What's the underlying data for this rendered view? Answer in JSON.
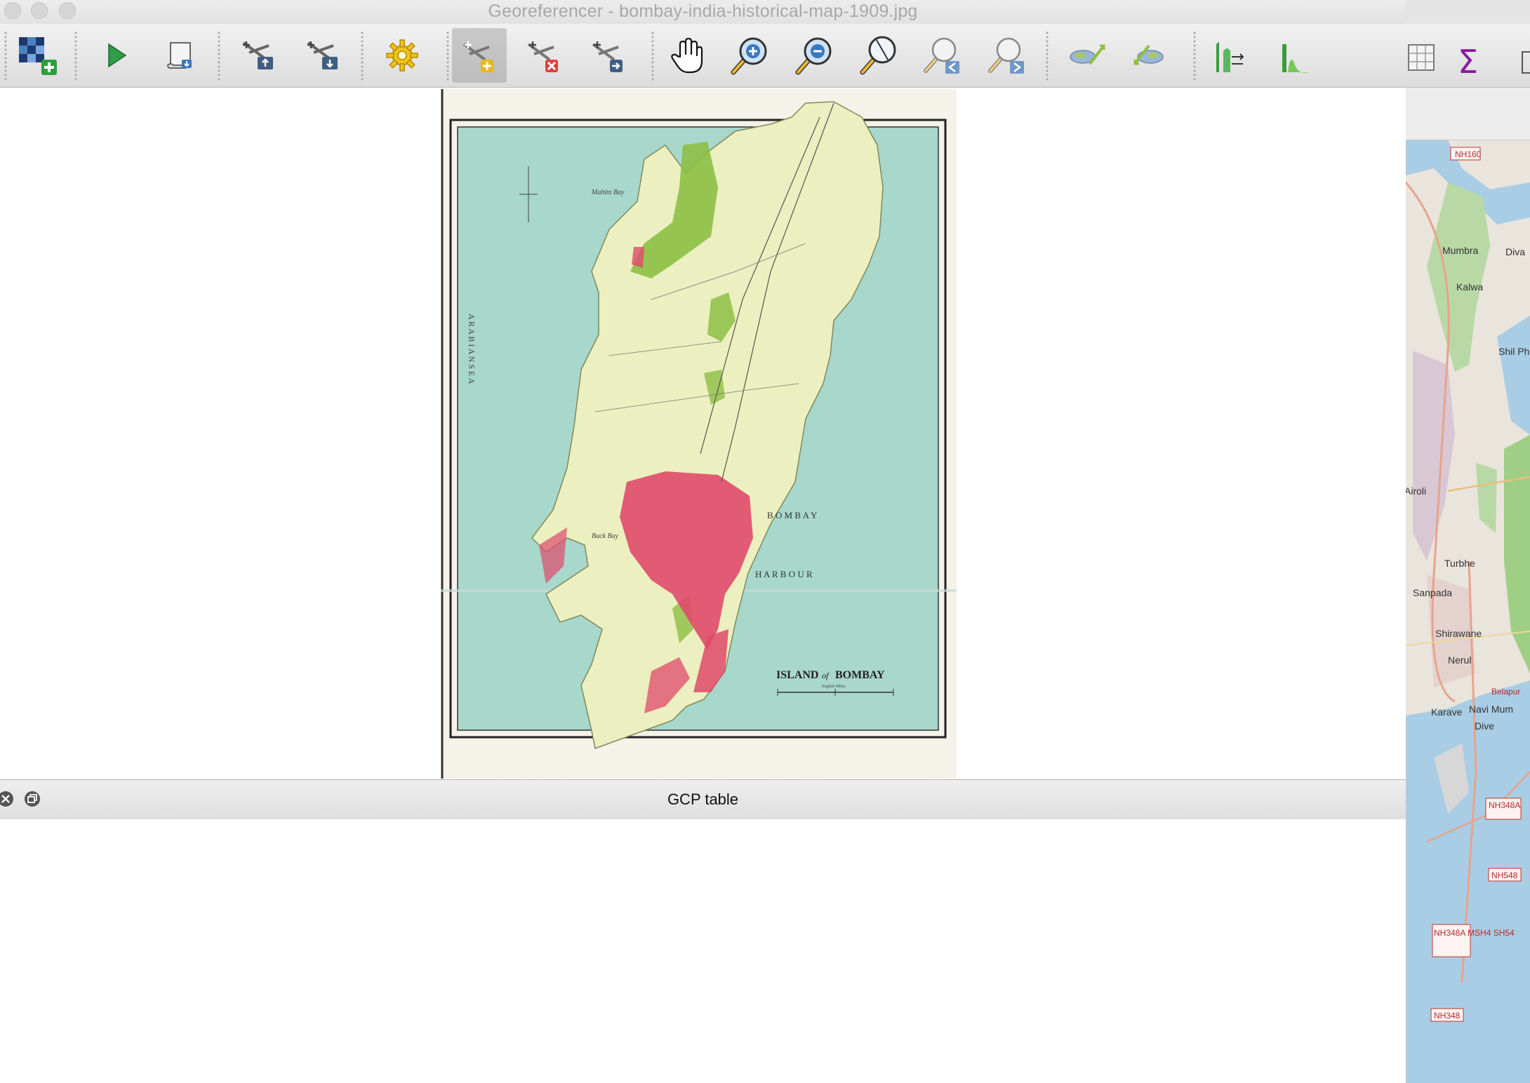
{
  "window": {
    "title": "Georeferencer - bombay-india-historical-map-1909.jpg"
  },
  "toolbar": {
    "buttons": [
      {
        "name": "open-raster",
        "icon": "open-raster-icon"
      },
      {
        "name": "start-georeferencing",
        "icon": "play-icon"
      },
      {
        "name": "generate-gdal-script",
        "icon": "script-icon"
      },
      {
        "name": "load-gcp-points",
        "icon": "load-gcp-icon"
      },
      {
        "name": "save-gcp-points",
        "icon": "save-gcp-icon"
      },
      {
        "name": "transformation-settings",
        "icon": "gear-icon"
      },
      {
        "name": "add-point",
        "icon": "add-point-icon"
      },
      {
        "name": "delete-point",
        "icon": "delete-point-icon"
      },
      {
        "name": "move-gcp-point",
        "icon": "move-point-icon"
      },
      {
        "name": "pan",
        "icon": "hand-icon"
      },
      {
        "name": "zoom-in",
        "icon": "zoom-in-icon"
      },
      {
        "name": "zoom-out",
        "icon": "zoom-out-icon"
      },
      {
        "name": "zoom-to-layer",
        "icon": "zoom-layer-icon"
      },
      {
        "name": "zoom-last",
        "icon": "zoom-last-icon"
      },
      {
        "name": "zoom-next",
        "icon": "zoom-next-icon"
      },
      {
        "name": "link-georeferencer-to-qgis",
        "icon": "link-geo-icon"
      },
      {
        "name": "link-qgis-to-georeferencer",
        "icon": "link-qgis-icon"
      },
      {
        "name": "full-histogram-stretch",
        "icon": "histogram-full-icon"
      },
      {
        "name": "local-histogram-stretch",
        "icon": "histogram-local-icon"
      }
    ]
  },
  "map": {
    "title_main": "ISLAND",
    "title_of": "of",
    "title_place": "BOMBAY",
    "label_bombay": "B O M B A Y",
    "label_harbour": "H A R B O U R",
    "label_sea": "A R A B I A N   S E A",
    "label_mahim": "Mahim Bay",
    "label_back": "Back Bay",
    "label_scale": "English Miles",
    "colors": {
      "sea": "#a8d7cb",
      "land": "#ecefbf",
      "green": "#8dbf45",
      "town": "#e04a6b"
    }
  },
  "gcp": {
    "title": "GCP table"
  },
  "background_map": {
    "labels": [
      "NH160",
      "Mumbra",
      "Diva",
      "Kalwa",
      "Shil Pha",
      "Airoli",
      "Turbhe",
      "Sanpada",
      "Shirawane",
      "Nerul",
      "Belapur",
      "Navi Mum",
      "Karave",
      "Dive",
      "NH348A",
      "NH548",
      "NH348A MSH4 SH54",
      "NH348"
    ]
  }
}
